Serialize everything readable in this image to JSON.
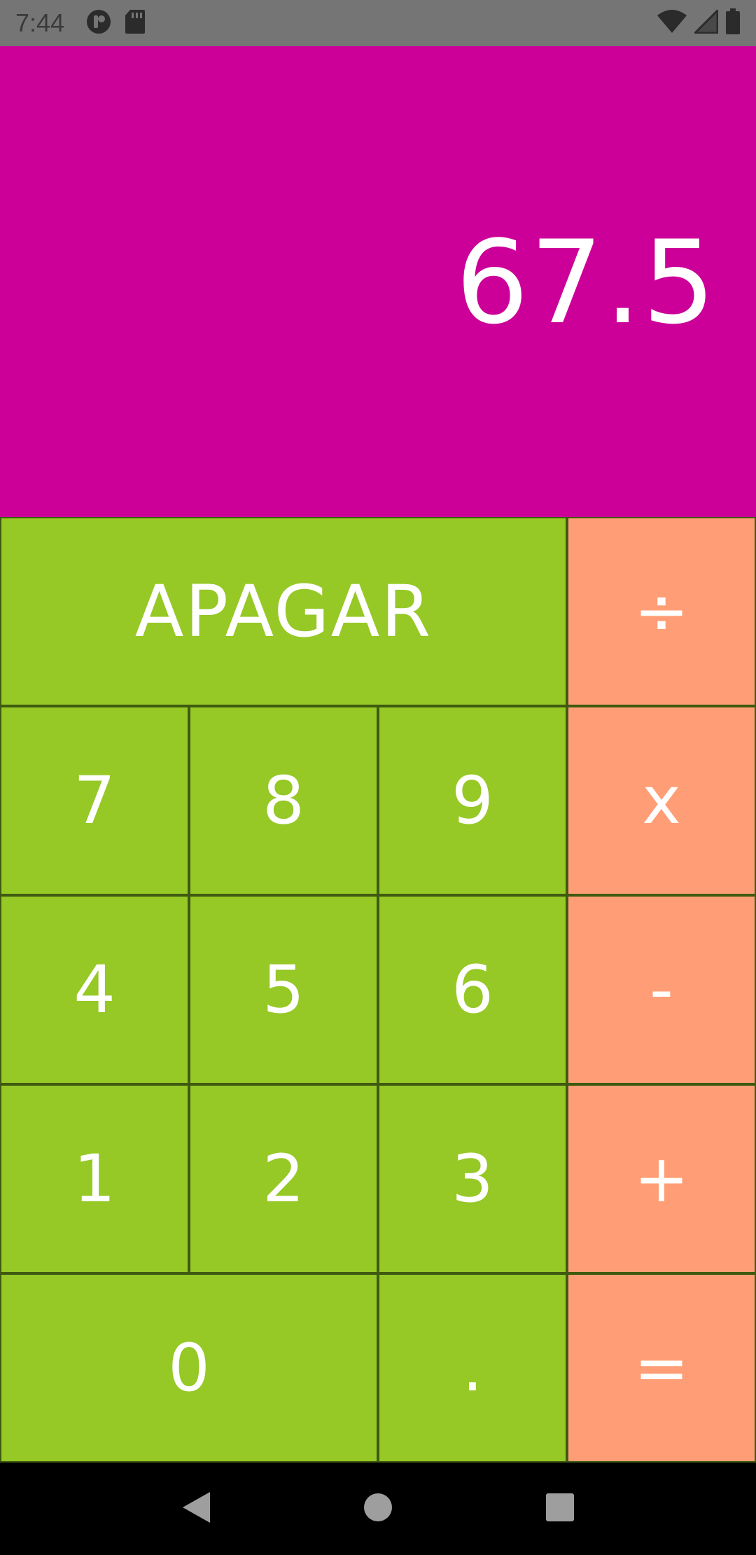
{
  "status_bar": {
    "time": "7:44",
    "icons": [
      "data-saver-icon",
      "sd-card-icon",
      "wifi-icon",
      "signal-icon",
      "battery-icon"
    ]
  },
  "display": {
    "value": "67.5",
    "background_color": "#cc0099"
  },
  "keypad": {
    "clear_label": "APAGAR",
    "divide_label": "÷",
    "multiply_label": "x",
    "subtract_label": "-",
    "add_label": "+",
    "equals_label": "=",
    "decimal_label": ".",
    "digits": {
      "d0": "0",
      "d1": "1",
      "d2": "2",
      "d3": "3",
      "d4": "4",
      "d5": "5",
      "d6": "6",
      "d7": "7",
      "d8": "8",
      "d9": "9"
    },
    "number_color": "#96c826",
    "operator_color": "#ff9e76"
  },
  "nav_bar": {
    "icons": [
      "back-icon",
      "home-icon",
      "recents-icon"
    ]
  }
}
